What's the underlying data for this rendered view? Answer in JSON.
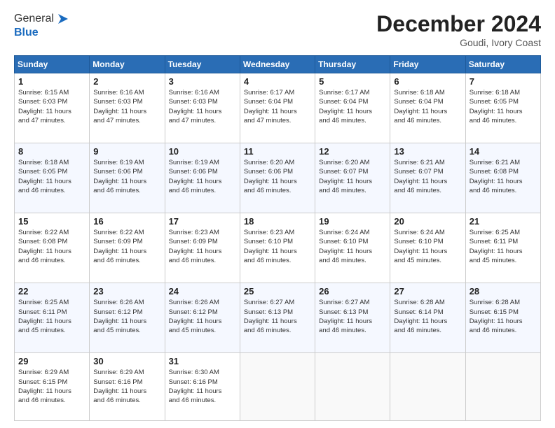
{
  "logo": {
    "line1": "General",
    "line2": "Blue"
  },
  "title": "December 2024",
  "subtitle": "Goudi, Ivory Coast",
  "header_days": [
    "Sunday",
    "Monday",
    "Tuesday",
    "Wednesday",
    "Thursday",
    "Friday",
    "Saturday"
  ],
  "weeks": [
    [
      {
        "day": "1",
        "info": "Sunrise: 6:15 AM\nSunset: 6:03 PM\nDaylight: 11 hours\nand 47 minutes."
      },
      {
        "day": "2",
        "info": "Sunrise: 6:16 AM\nSunset: 6:03 PM\nDaylight: 11 hours\nand 47 minutes."
      },
      {
        "day": "3",
        "info": "Sunrise: 6:16 AM\nSunset: 6:03 PM\nDaylight: 11 hours\nand 47 minutes."
      },
      {
        "day": "4",
        "info": "Sunrise: 6:17 AM\nSunset: 6:04 PM\nDaylight: 11 hours\nand 47 minutes."
      },
      {
        "day": "5",
        "info": "Sunrise: 6:17 AM\nSunset: 6:04 PM\nDaylight: 11 hours\nand 46 minutes."
      },
      {
        "day": "6",
        "info": "Sunrise: 6:18 AM\nSunset: 6:04 PM\nDaylight: 11 hours\nand 46 minutes."
      },
      {
        "day": "7",
        "info": "Sunrise: 6:18 AM\nSunset: 6:05 PM\nDaylight: 11 hours\nand 46 minutes."
      }
    ],
    [
      {
        "day": "8",
        "info": "Sunrise: 6:18 AM\nSunset: 6:05 PM\nDaylight: 11 hours\nand 46 minutes."
      },
      {
        "day": "9",
        "info": "Sunrise: 6:19 AM\nSunset: 6:06 PM\nDaylight: 11 hours\nand 46 minutes."
      },
      {
        "day": "10",
        "info": "Sunrise: 6:19 AM\nSunset: 6:06 PM\nDaylight: 11 hours\nand 46 minutes."
      },
      {
        "day": "11",
        "info": "Sunrise: 6:20 AM\nSunset: 6:06 PM\nDaylight: 11 hours\nand 46 minutes."
      },
      {
        "day": "12",
        "info": "Sunrise: 6:20 AM\nSunset: 6:07 PM\nDaylight: 11 hours\nand 46 minutes."
      },
      {
        "day": "13",
        "info": "Sunrise: 6:21 AM\nSunset: 6:07 PM\nDaylight: 11 hours\nand 46 minutes."
      },
      {
        "day": "14",
        "info": "Sunrise: 6:21 AM\nSunset: 6:08 PM\nDaylight: 11 hours\nand 46 minutes."
      }
    ],
    [
      {
        "day": "15",
        "info": "Sunrise: 6:22 AM\nSunset: 6:08 PM\nDaylight: 11 hours\nand 46 minutes."
      },
      {
        "day": "16",
        "info": "Sunrise: 6:22 AM\nSunset: 6:09 PM\nDaylight: 11 hours\nand 46 minutes."
      },
      {
        "day": "17",
        "info": "Sunrise: 6:23 AM\nSunset: 6:09 PM\nDaylight: 11 hours\nand 46 minutes."
      },
      {
        "day": "18",
        "info": "Sunrise: 6:23 AM\nSunset: 6:10 PM\nDaylight: 11 hours\nand 46 minutes."
      },
      {
        "day": "19",
        "info": "Sunrise: 6:24 AM\nSunset: 6:10 PM\nDaylight: 11 hours\nand 46 minutes."
      },
      {
        "day": "20",
        "info": "Sunrise: 6:24 AM\nSunset: 6:10 PM\nDaylight: 11 hours\nand 45 minutes."
      },
      {
        "day": "21",
        "info": "Sunrise: 6:25 AM\nSunset: 6:11 PM\nDaylight: 11 hours\nand 45 minutes."
      }
    ],
    [
      {
        "day": "22",
        "info": "Sunrise: 6:25 AM\nSunset: 6:11 PM\nDaylight: 11 hours\nand 45 minutes."
      },
      {
        "day": "23",
        "info": "Sunrise: 6:26 AM\nSunset: 6:12 PM\nDaylight: 11 hours\nand 45 minutes."
      },
      {
        "day": "24",
        "info": "Sunrise: 6:26 AM\nSunset: 6:12 PM\nDaylight: 11 hours\nand 45 minutes."
      },
      {
        "day": "25",
        "info": "Sunrise: 6:27 AM\nSunset: 6:13 PM\nDaylight: 11 hours\nand 46 minutes."
      },
      {
        "day": "26",
        "info": "Sunrise: 6:27 AM\nSunset: 6:13 PM\nDaylight: 11 hours\nand 46 minutes."
      },
      {
        "day": "27",
        "info": "Sunrise: 6:28 AM\nSunset: 6:14 PM\nDaylight: 11 hours\nand 46 minutes."
      },
      {
        "day": "28",
        "info": "Sunrise: 6:28 AM\nSunset: 6:15 PM\nDaylight: 11 hours\nand 46 minutes."
      }
    ],
    [
      {
        "day": "29",
        "info": "Sunrise: 6:29 AM\nSunset: 6:15 PM\nDaylight: 11 hours\nand 46 minutes."
      },
      {
        "day": "30",
        "info": "Sunrise: 6:29 AM\nSunset: 6:16 PM\nDaylight: 11 hours\nand 46 minutes."
      },
      {
        "day": "31",
        "info": "Sunrise: 6:30 AM\nSunset: 6:16 PM\nDaylight: 11 hours\nand 46 minutes."
      },
      {
        "day": "",
        "info": ""
      },
      {
        "day": "",
        "info": ""
      },
      {
        "day": "",
        "info": ""
      },
      {
        "day": "",
        "info": ""
      }
    ]
  ]
}
